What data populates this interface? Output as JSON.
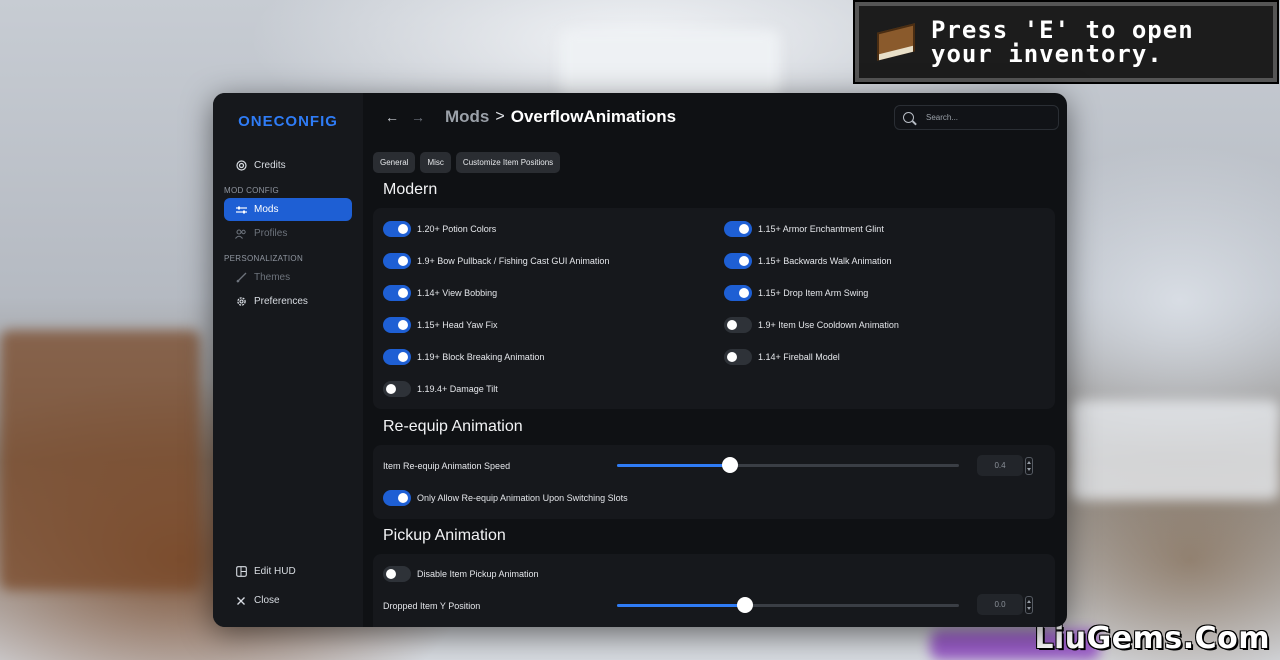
{
  "toast": {
    "message": "Press 'E' to open your inventory."
  },
  "watermark": "LiuGems.Com",
  "sidebar": {
    "logo": "ONECONFIG",
    "credits": "Credits",
    "section_mod_config": "MOD CONFIG",
    "mods": "Mods",
    "profiles": "Profiles",
    "section_personalization": "PERSONALIZATION",
    "themes": "Themes",
    "preferences": "Preferences",
    "edit_hud": "Edit HUD",
    "close": "Close"
  },
  "header": {
    "back": "←",
    "forward": "→",
    "crumb_parent": "Mods",
    "crumb_sep": ">",
    "crumb_current": "OverflowAnimations",
    "search_placeholder": "Search..."
  },
  "tabs": [
    "General",
    "Misc",
    "Customize Item Positions"
  ],
  "sections": {
    "modern": {
      "title": "Modern",
      "left": [
        {
          "label": "1.20+ Potion Colors",
          "on": true
        },
        {
          "label": "1.9+ Bow Pullback / Fishing Cast GUI Animation",
          "on": true
        },
        {
          "label": "1.14+ View Bobbing",
          "on": true
        },
        {
          "label": "1.15+ Head Yaw Fix",
          "on": true
        },
        {
          "label": "1.19+ Block Breaking Animation",
          "on": true
        },
        {
          "label": "1.19.4+ Damage Tilt",
          "on": false
        }
      ],
      "right": [
        {
          "label": "1.15+ Armor Enchantment Glint",
          "on": true
        },
        {
          "label": "1.15+ Backwards Walk Animation",
          "on": true
        },
        {
          "label": "1.15+ Drop Item Arm Swing",
          "on": true
        },
        {
          "label": "1.9+ Item Use Cooldown Animation",
          "on": false
        },
        {
          "label": "1.14+ Fireball Model",
          "on": false
        }
      ]
    },
    "reequip": {
      "title": "Re-equip Animation",
      "slider_label": "Item Re-equip Animation Speed",
      "slider_value": "0.4",
      "slider_fraction": 0.33,
      "toggle_label": "Only Allow Re-equip Animation Upon Switching Slots",
      "toggle_on": true
    },
    "pickup": {
      "title": "Pickup Animation",
      "toggle_label": "Disable Item Pickup Animation",
      "toggle_on": false,
      "slider_label": "Dropped Item Y Position",
      "slider_value": "0.0",
      "slider_fraction": 0.375
    }
  },
  "colors": {
    "accent": "#1e5fd4",
    "window_bg": "#0f1114",
    "panel_bg": "#16181c"
  }
}
